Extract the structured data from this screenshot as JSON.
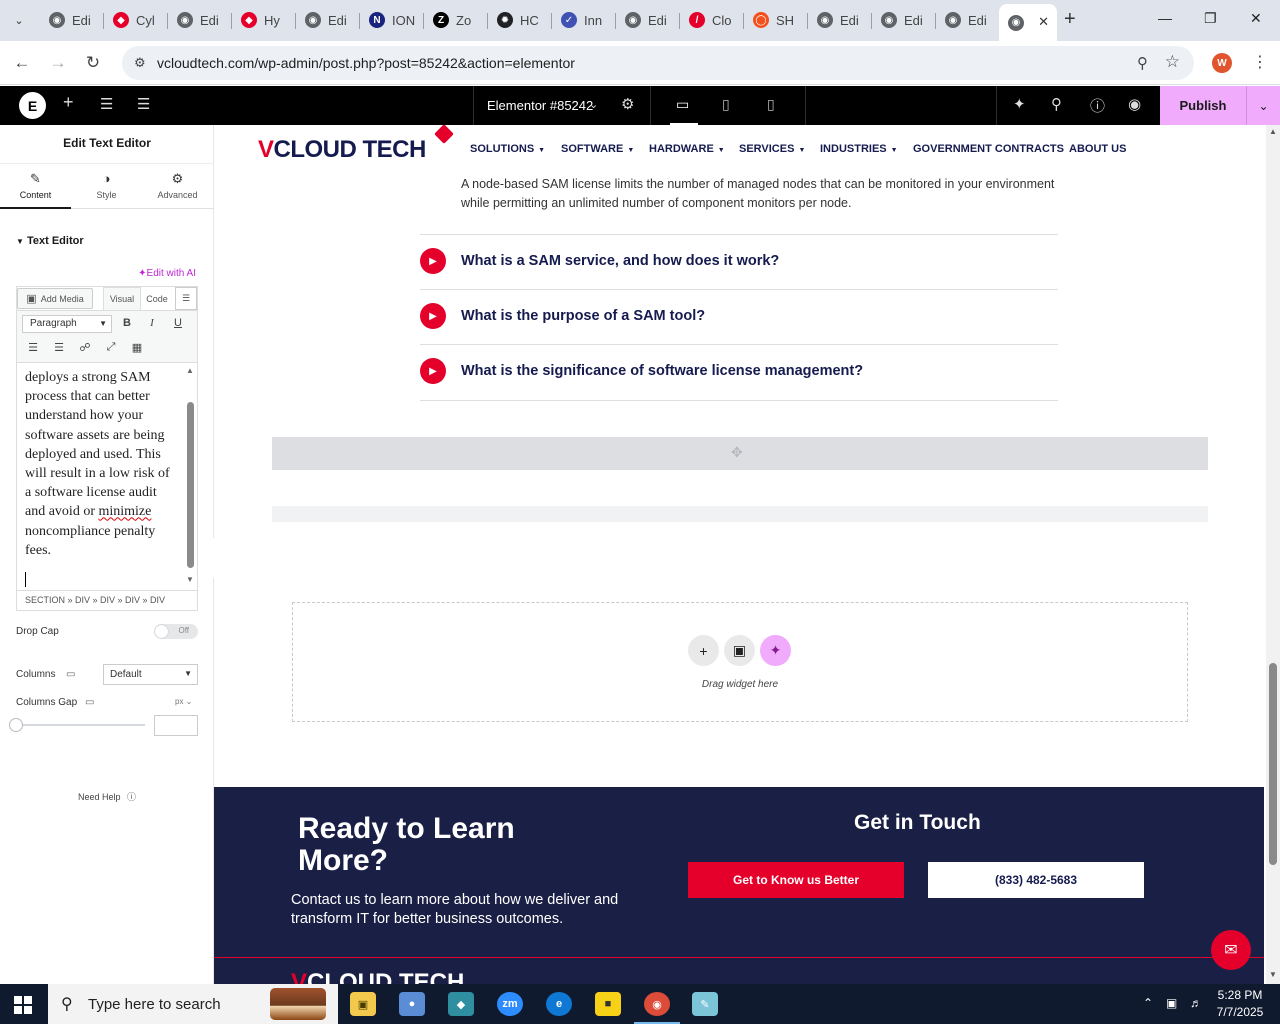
{
  "browser": {
    "tabs": [
      {
        "label": "Edi",
        "icon": "globe-icon",
        "color": "#5f6368"
      },
      {
        "label": "Cyl",
        "icon": "red-diamond-icon",
        "color": "#e4002b"
      },
      {
        "label": "Edi",
        "icon": "globe-icon",
        "color": "#5f6368"
      },
      {
        "label": "Hy",
        "icon": "red-diamond-icon",
        "color": "#e4002b"
      },
      {
        "label": "Edi",
        "icon": "globe-icon",
        "color": "#5f6368"
      },
      {
        "label": "ION",
        "icon": "n-logo-icon",
        "color": "#1a237e"
      },
      {
        "label": "Zo",
        "icon": "z-logo-icon",
        "color": "#000000"
      },
      {
        "label": "HC",
        "icon": "openai-icon",
        "color": "#202124"
      },
      {
        "label": "Inn",
        "icon": "check-logo-icon",
        "color": "#3f51b5"
      },
      {
        "label": "Edi",
        "icon": "globe-icon",
        "color": "#5f6368"
      },
      {
        "label": "Clo",
        "icon": "slash-logo-icon",
        "color": "#e4002b"
      },
      {
        "label": "SH",
        "icon": "ring-logo-icon",
        "color": "#f4511e"
      },
      {
        "label": "Edi",
        "icon": "globe-icon",
        "color": "#5f6368"
      },
      {
        "label": "Edi",
        "icon": "globe-icon",
        "color": "#5f6368"
      },
      {
        "label": "Edi",
        "icon": "globe-icon",
        "color": "#5f6368"
      },
      {
        "label": "",
        "icon": "globe-icon",
        "color": "#5f6368",
        "active": true
      }
    ],
    "url": "vcloudtech.com/wp-admin/post.php?post=85242&action=elementor",
    "profile_initial": "W"
  },
  "elementor": {
    "logo": "E",
    "document_name": "Elementor #85242",
    "publish_label": "Publish",
    "panel": {
      "title": "Edit Text Editor",
      "tabs": [
        {
          "label": "Content",
          "icon": "pencil-icon",
          "active": true
        },
        {
          "label": "Style",
          "icon": "half-circle-icon"
        },
        {
          "label": "Advanced",
          "icon": "gear-icon"
        }
      ],
      "section_title": "Text Editor",
      "edit_with_ai": "Edit with AI",
      "add_media": "Add Media",
      "visual_tab": "Visual",
      "code_tab": "Code",
      "format_select": "Paragraph",
      "editor_lines": [
        "deploys a strong SAM",
        "process that can better",
        "understand how your",
        "software assets are being",
        "deployed and used. This",
        "will result in a low risk of",
        "a software license audit",
        "and avoid or "
      ],
      "editor_squiggle_word": "minimize",
      "editor_lines_after": [
        "noncompliance penalty",
        "fees."
      ],
      "element_path": "SECTION » DIV » DIV » DIV » DIV",
      "drop_cap_label": "Drop Cap",
      "drop_cap_value": "Off",
      "columns_label": "Columns",
      "columns_value": "Default",
      "columns_gap_label": "Columns Gap",
      "columns_gap_unit": "px",
      "need_help": "Need Help"
    }
  },
  "site": {
    "brand_v": "V",
    "brand_rest": "CLOUD TECH",
    "nav": [
      {
        "label": "SOLUTIONS",
        "dropdown": true
      },
      {
        "label": "SOFTWARE",
        "dropdown": true
      },
      {
        "label": "HARDWARE",
        "dropdown": true
      },
      {
        "label": "SERVICES",
        "dropdown": true
      },
      {
        "label": "INDUSTRIES",
        "dropdown": true
      },
      {
        "label": "GOVERNMENT CONTRACTS",
        "dropdown": false
      },
      {
        "label": "ABOUT US",
        "dropdown": false
      }
    ],
    "faq_answer": "A node-based SAM license limits the number of managed nodes that can be monitored in your environment while permitting an unlimited number of component monitors per node.",
    "faq_questions": [
      "What is a SAM service, and how does it work?",
      "What is the purpose of a SAM tool?",
      "What is the significance of software license management?"
    ],
    "drag_widget_text": "Drag widget here",
    "footer": {
      "heading": "Ready to Learn More?",
      "paragraph": "Contact us to learn more about how we deliver and transform IT for better business outcomes.",
      "get_in_touch": "Get in Touch",
      "button_primary": "Get to Know us Better",
      "button_phone": "(833) 482-5683"
    },
    "colors": {
      "brand_red": "#e4002b",
      "navy": "#1a1f45",
      "ai_pink": "#f0abfc"
    }
  },
  "taskbar": {
    "search_placeholder": "Type here to search",
    "time": "5:28 PM",
    "date": "7/7/2025",
    "apps": [
      "file-explorer-icon",
      "paint-icon",
      "app-icon",
      "zoom-icon",
      "edge-icon",
      "sticky-notes-icon",
      "chrome-icon",
      "notepad-icon"
    ]
  }
}
